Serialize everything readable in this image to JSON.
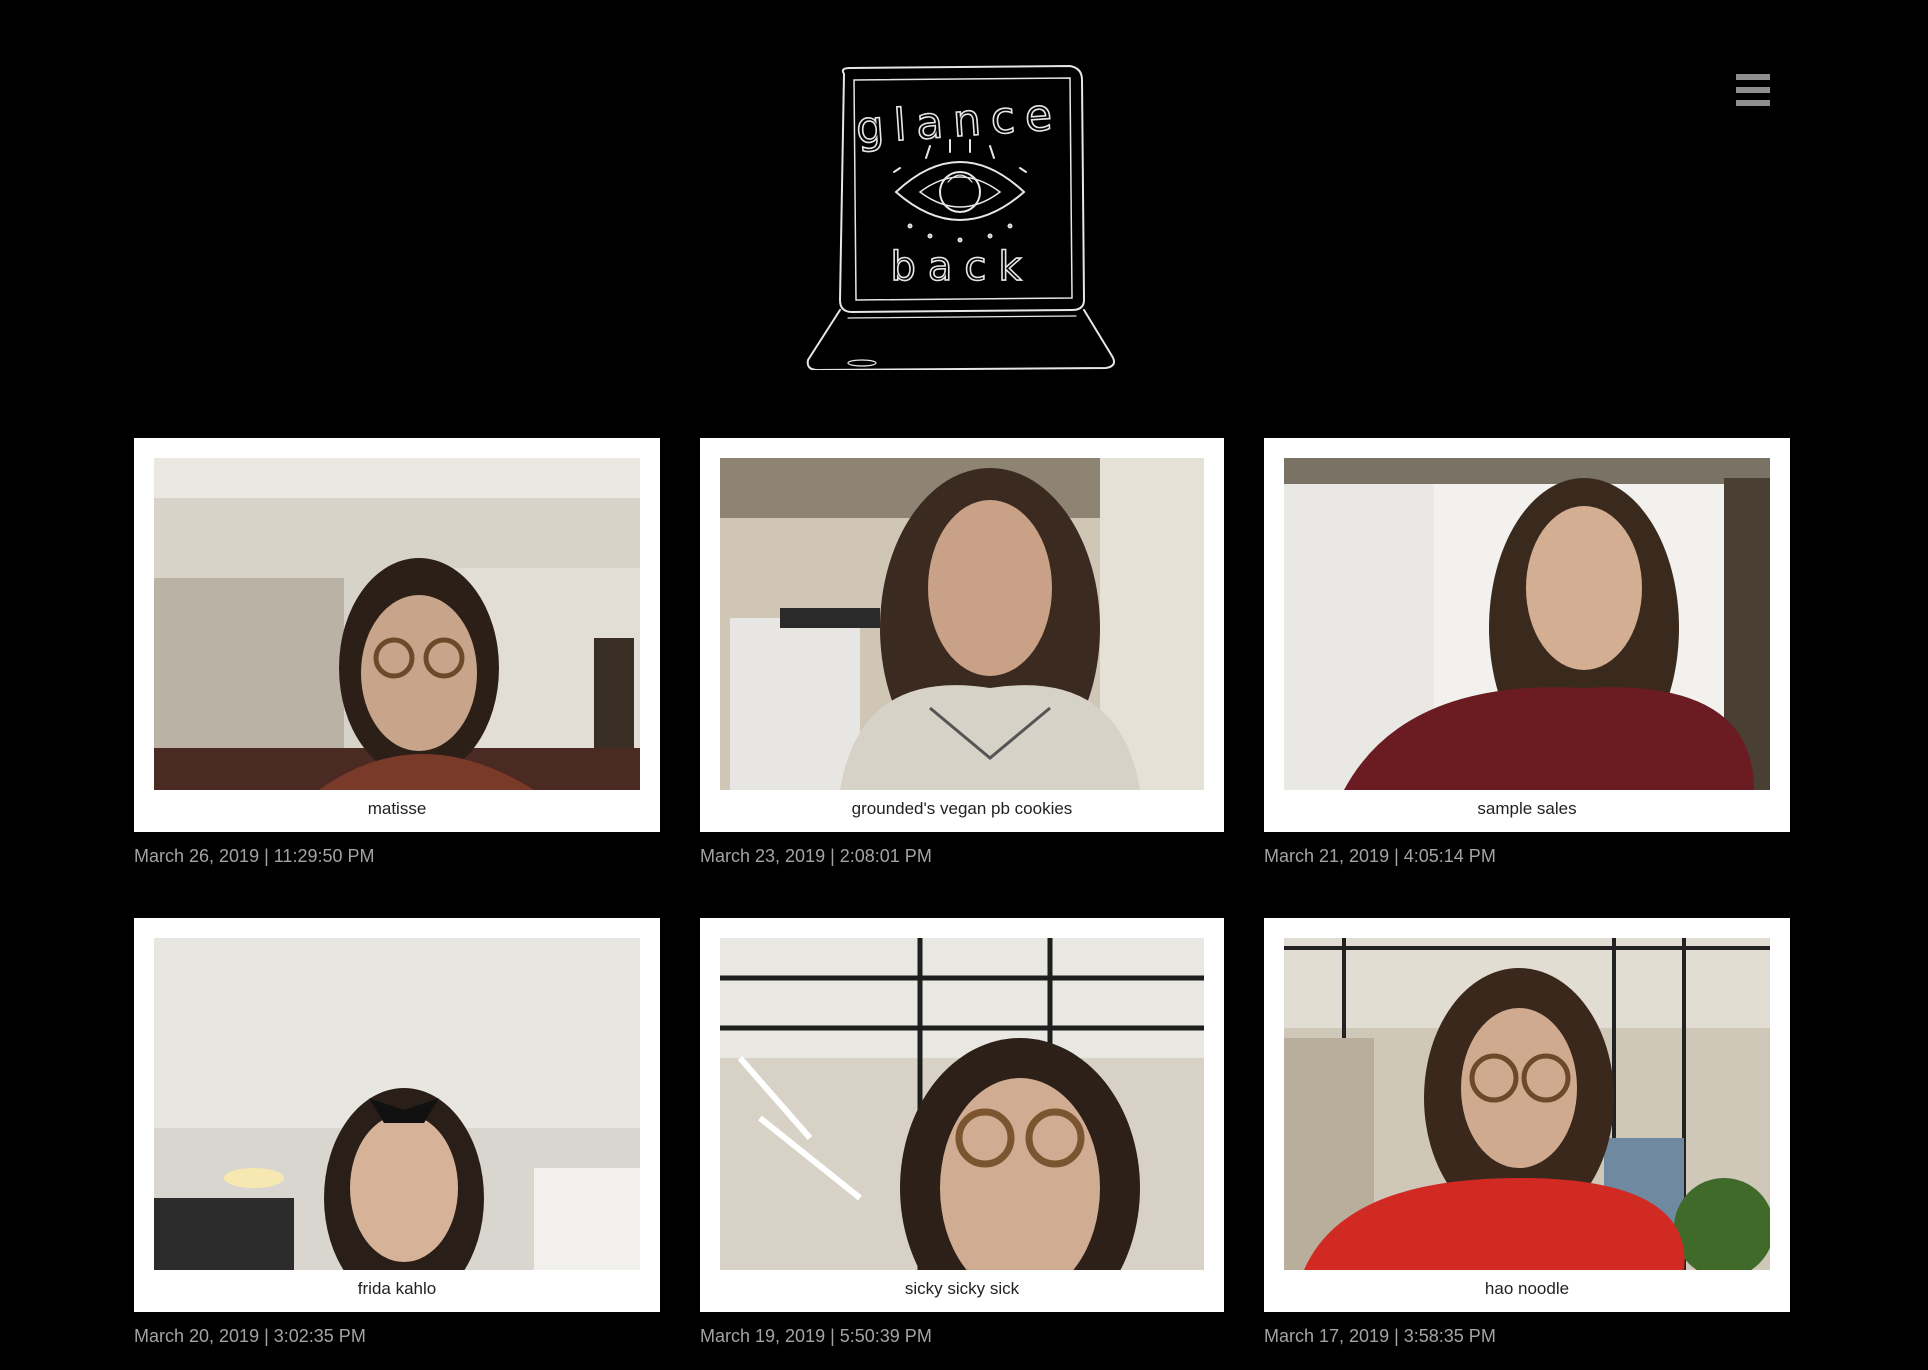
{
  "header": {
    "logo_text_top": "glance",
    "logo_text_bottom": "back",
    "menu_icon": "hamburger-icon"
  },
  "posts": [
    {
      "caption": "matisse",
      "timestamp": "March 26, 2019 | 11:29:50 PM"
    },
    {
      "caption": "grounded's vegan pb cookies",
      "timestamp": "March 23, 2019 | 2:08:01 PM"
    },
    {
      "caption": "sample sales",
      "timestamp": "March 21, 2019 | 4:05:14 PM"
    },
    {
      "caption": "frida kahlo",
      "timestamp": "March 20, 2019 | 3:02:35 PM"
    },
    {
      "caption": "sicky sicky sick",
      "timestamp": "March 19, 2019 | 5:50:39 PM"
    },
    {
      "caption": "hao noodle",
      "timestamp": "March 17, 2019 | 3:58:35 PM"
    }
  ]
}
